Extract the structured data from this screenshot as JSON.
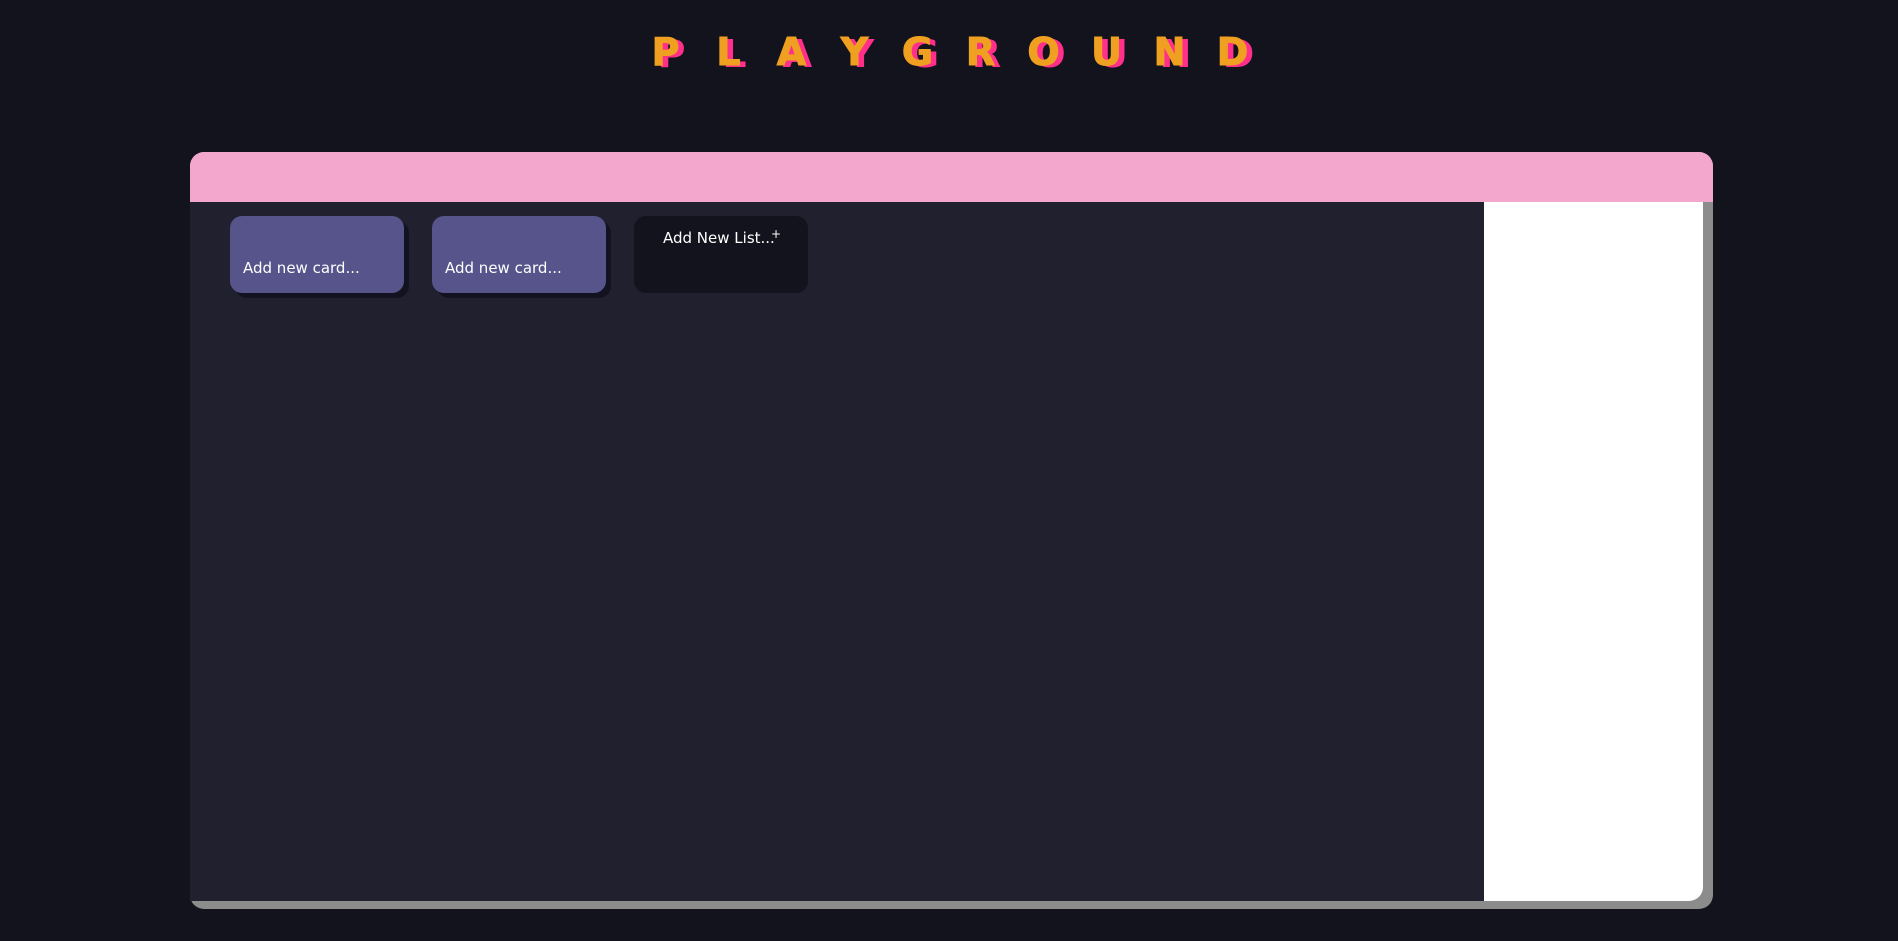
{
  "app": {
    "title_letters": [
      "P",
      "L",
      "A",
      "Y",
      "G",
      "R",
      "O",
      "U",
      "N",
      "D"
    ]
  },
  "lists": [
    {
      "add_card_placeholder": "Add new card..."
    },
    {
      "add_card_placeholder": "Add new card..."
    }
  ],
  "add_list": {
    "label": "Add New List...",
    "icon": "plus-icon",
    "icon_glyph": "+"
  },
  "colors": {
    "background": "#13131e",
    "board": "#20202f",
    "header": "#f4a7cd",
    "list_card": "#56548a",
    "title_primary": "#f0a020",
    "title_shadow": "#ff2f8a",
    "panel": "#ffffff"
  }
}
